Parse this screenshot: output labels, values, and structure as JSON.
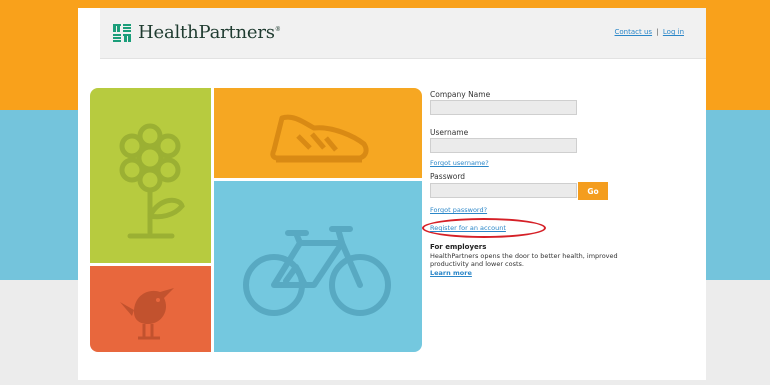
{
  "brand": {
    "name": "HealthPartners",
    "trademark": "®"
  },
  "header": {
    "contact_label": "Contact us",
    "separator": "|",
    "login_label": "Log in"
  },
  "form": {
    "company_label": "Company Name",
    "company_value": "",
    "username_label": "Username",
    "username_value": "",
    "forgot_username": "Forgot username?",
    "password_label": "Password",
    "password_value": "",
    "go_label": "Go",
    "forgot_password": "Forgot password?",
    "register_label": "Register for an account"
  },
  "employers": {
    "title": "For employers",
    "text": "HealthPartners opens the door to better health, improved productivity and lower costs.",
    "learn_more": "Learn more"
  },
  "colors": {
    "orange": "#f9a11b",
    "blue": "#74c4dc",
    "green": "#b7cb3f",
    "red_orange": "#e8673d",
    "link": "#2a86c8",
    "annotation": "#d52027"
  },
  "icons": [
    "flower-icon",
    "shoe-icon",
    "bicycle-icon",
    "bird-icon",
    "logo-mark-icon"
  ]
}
